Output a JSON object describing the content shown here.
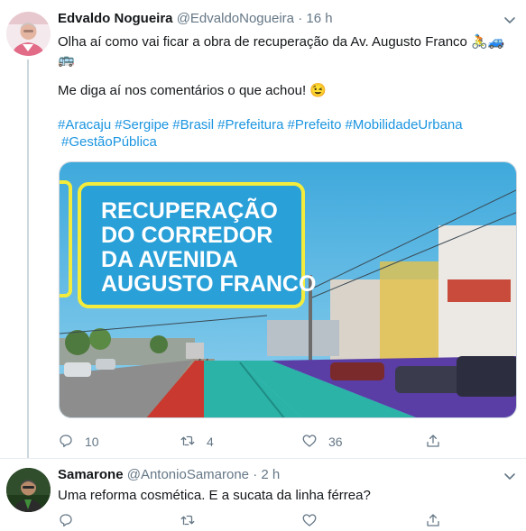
{
  "tweets": [
    {
      "author": {
        "name": "Edvaldo Nogueira",
        "handle": "@EdvaldoNogueira",
        "separator": "·",
        "time": "16 h"
      },
      "text_line1": "Olha aí como vai ficar a obra de recuperação da Av. Augusto Franco 🚴🚙",
      "text_line2": "🚌",
      "text_line3": "Me diga aí nos comentários o que achou! 😉",
      "hashtags": [
        "#Aracaju",
        "#Sergipe",
        "#Brasil",
        "#Prefeitura",
        "#Prefeito",
        "#MobilidadeUrbana",
        "#GestãoPública"
      ],
      "media": {
        "title_lines": [
          "RECUPERAÇÃO",
          "DO CORREDOR",
          "DA AVENIDA",
          "AUGUSTO FRANCO"
        ]
      },
      "actions": {
        "reply_count": "10",
        "retweet_count": "4",
        "like_count": "36"
      }
    },
    {
      "author": {
        "name": "Samarone",
        "handle": "@AntonioSamarone",
        "separator": "·",
        "time": "2 h"
      },
      "text_line1": "Uma reforma cosmética. E a sucata da linha férrea?"
    }
  ],
  "colors": {
    "link": "#1b95e0",
    "text": "#14171a",
    "secondary": "#657786",
    "banner_yellow": "#f3ec3c",
    "banner_blue": "#2aa0d8",
    "lane_teal": "#2bb3a8",
    "lane_red": "#c9392f",
    "lane_purple": "#5a3ea6"
  },
  "icons": [
    "chevron-down-icon",
    "reply-icon",
    "retweet-icon",
    "like-icon",
    "share-icon"
  ]
}
